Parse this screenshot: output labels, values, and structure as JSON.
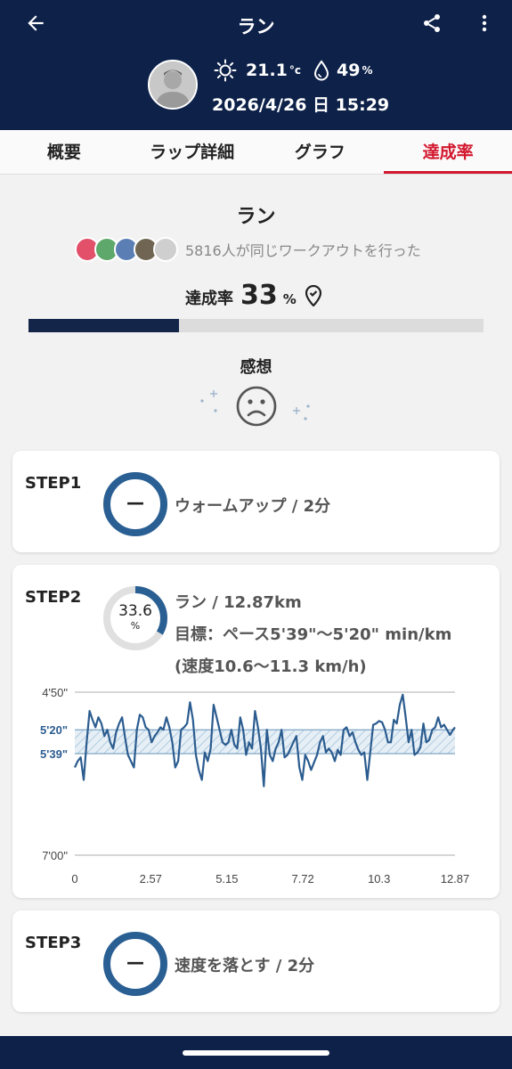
{
  "header": {
    "title": "ラン",
    "temperature": "21.1",
    "temperature_unit": "°c",
    "humidity": "49",
    "humidity_unit": "%",
    "datetime": "2026/4/26 日 15:29",
    "icons": [
      "back-arrow-icon",
      "share-icon",
      "more-vert-icon",
      "sun-icon",
      "droplet-icon"
    ]
  },
  "tabs": [
    {
      "label": "概要",
      "active": false
    },
    {
      "label": "ラップ詳細",
      "active": false
    },
    {
      "label": "グラフ",
      "active": false
    },
    {
      "label": "達成率",
      "active": true
    }
  ],
  "summary": {
    "workout_title": "ラン",
    "people_text": "5816人が同じワークアウトを行った",
    "rate_label": "達成率",
    "rate_value": "33",
    "rate_unit": "%",
    "progress_fraction": 0.33,
    "feeling_label": "感想",
    "feeling_icon": "sad-face-icon"
  },
  "steps": [
    {
      "label": "STEP1",
      "ring_text": "—",
      "text": "ウォームアップ / 2分"
    },
    {
      "label": "STEP2",
      "ring_value": "33.6",
      "ring_unit": "%",
      "ring_fraction": 0.336,
      "line1": "ラン / 12.87km",
      "line2": "目標：ペース5'39\"〜5'20\" min/km",
      "line3": "(速度10.6〜11.3 km/h)"
    },
    {
      "label": "STEP3",
      "ring_text": "—",
      "text": "速度を落とす / 2分"
    }
  ],
  "colors": {
    "header_bg": "#0d2149",
    "accent_red": "#d3172e",
    "ring_blue": "#2a5f93",
    "line_blue": "#2b5c8f",
    "target_band": "#9fbfd8"
  },
  "chart_data": {
    "type": "line",
    "xlabel": "",
    "ylabel": "",
    "x_ticks": [
      "0",
      "2.57",
      "5.15",
      "7.72",
      "10.3",
      "12.87"
    ],
    "xlim": [
      0,
      12.87
    ],
    "y_ticks": [
      "4'50\"",
      "5'20\"",
      "5'39\"",
      "7'00\""
    ],
    "y_ticks_highlighted": [
      "5'20\"",
      "5'39\""
    ],
    "ylim_seconds_per_km": [
      290,
      420
    ],
    "target_band_seconds_per_km": [
      320,
      339
    ],
    "series": [
      {
        "x": [
          0,
          0.1,
          0.2,
          0.3,
          0.4,
          0.5,
          0.6,
          0.7,
          0.8,
          0.9,
          1.0,
          1.1,
          1.2,
          1.3,
          1.4,
          1.5,
          1.6,
          1.7,
          1.8,
          1.9,
          2.0,
          2.1,
          2.2,
          2.3,
          2.4,
          2.5,
          2.6,
          2.7,
          2.8,
          2.9,
          3.0,
          3.1,
          3.2,
          3.3,
          3.4,
          3.5,
          3.6,
          3.7,
          3.8,
          3.9,
          4.0,
          4.1,
          4.2,
          4.3,
          4.4,
          4.5,
          4.6,
          4.7,
          4.8,
          4.9,
          5.0,
          5.1,
          5.2,
          5.3,
          5.4,
          5.5,
          5.6,
          5.7,
          5.8,
          5.9,
          6.0,
          6.1,
          6.2,
          6.3,
          6.4,
          6.5,
          6.6,
          6.7,
          6.8,
          6.9,
          7.0,
          7.1,
          7.2,
          7.3,
          7.4,
          7.5,
          7.6,
          7.7,
          7.8,
          7.9,
          8.0,
          8.1,
          8.2,
          8.3,
          8.4,
          8.5,
          8.6,
          8.7,
          8.8,
          8.9,
          9.0,
          9.1,
          9.2,
          9.3,
          9.4,
          9.5,
          9.6,
          9.7,
          9.8,
          9.9,
          10.0,
          10.1,
          10.2,
          10.3,
          10.4,
          10.5,
          10.6,
          10.7,
          10.8,
          10.9,
          11.0,
          11.1,
          11.2,
          11.3,
          11.4,
          11.5,
          11.6,
          11.7,
          11.8,
          11.9,
          12.0,
          12.1,
          12.2,
          12.3,
          12.4,
          12.5,
          12.6,
          12.7,
          12.8,
          12.87
        ],
        "y": [
          350,
          345,
          342,
          360,
          330,
          305,
          312,
          318,
          310,
          315,
          325,
          320,
          330,
          335,
          322,
          315,
          310,
          326,
          340,
          345,
          350,
          320,
          308,
          310,
          318,
          320,
          330,
          325,
          322,
          318,
          320,
          310,
          318,
          330,
          350,
          345,
          320,
          318,
          315,
          298,
          312,
          340,
          352,
          360,
          338,
          345,
          335,
          300,
          310,
          320,
          330,
          332,
          330,
          320,
          332,
          335,
          310,
          320,
          340,
          330,
          335,
          305,
          318,
          335,
          365,
          320,
          340,
          345,
          335,
          330,
          320,
          342,
          340,
          335,
          330,
          325,
          350,
          360,
          340,
          345,
          352,
          346,
          340,
          330,
          325,
          338,
          335,
          338,
          345,
          336,
          340,
          320,
          318,
          325,
          322,
          330,
          336,
          340,
          338,
          360,
          338,
          316,
          315,
          313,
          314,
          320,
          330,
          330,
          312,
          315,
          300,
          292,
          310,
          330,
          320,
          340,
          338,
          334,
          315,
          330,
          328,
          320,
          318,
          310,
          318,
          316,
          320,
          324,
          320,
          318
        ]
      }
    ]
  }
}
